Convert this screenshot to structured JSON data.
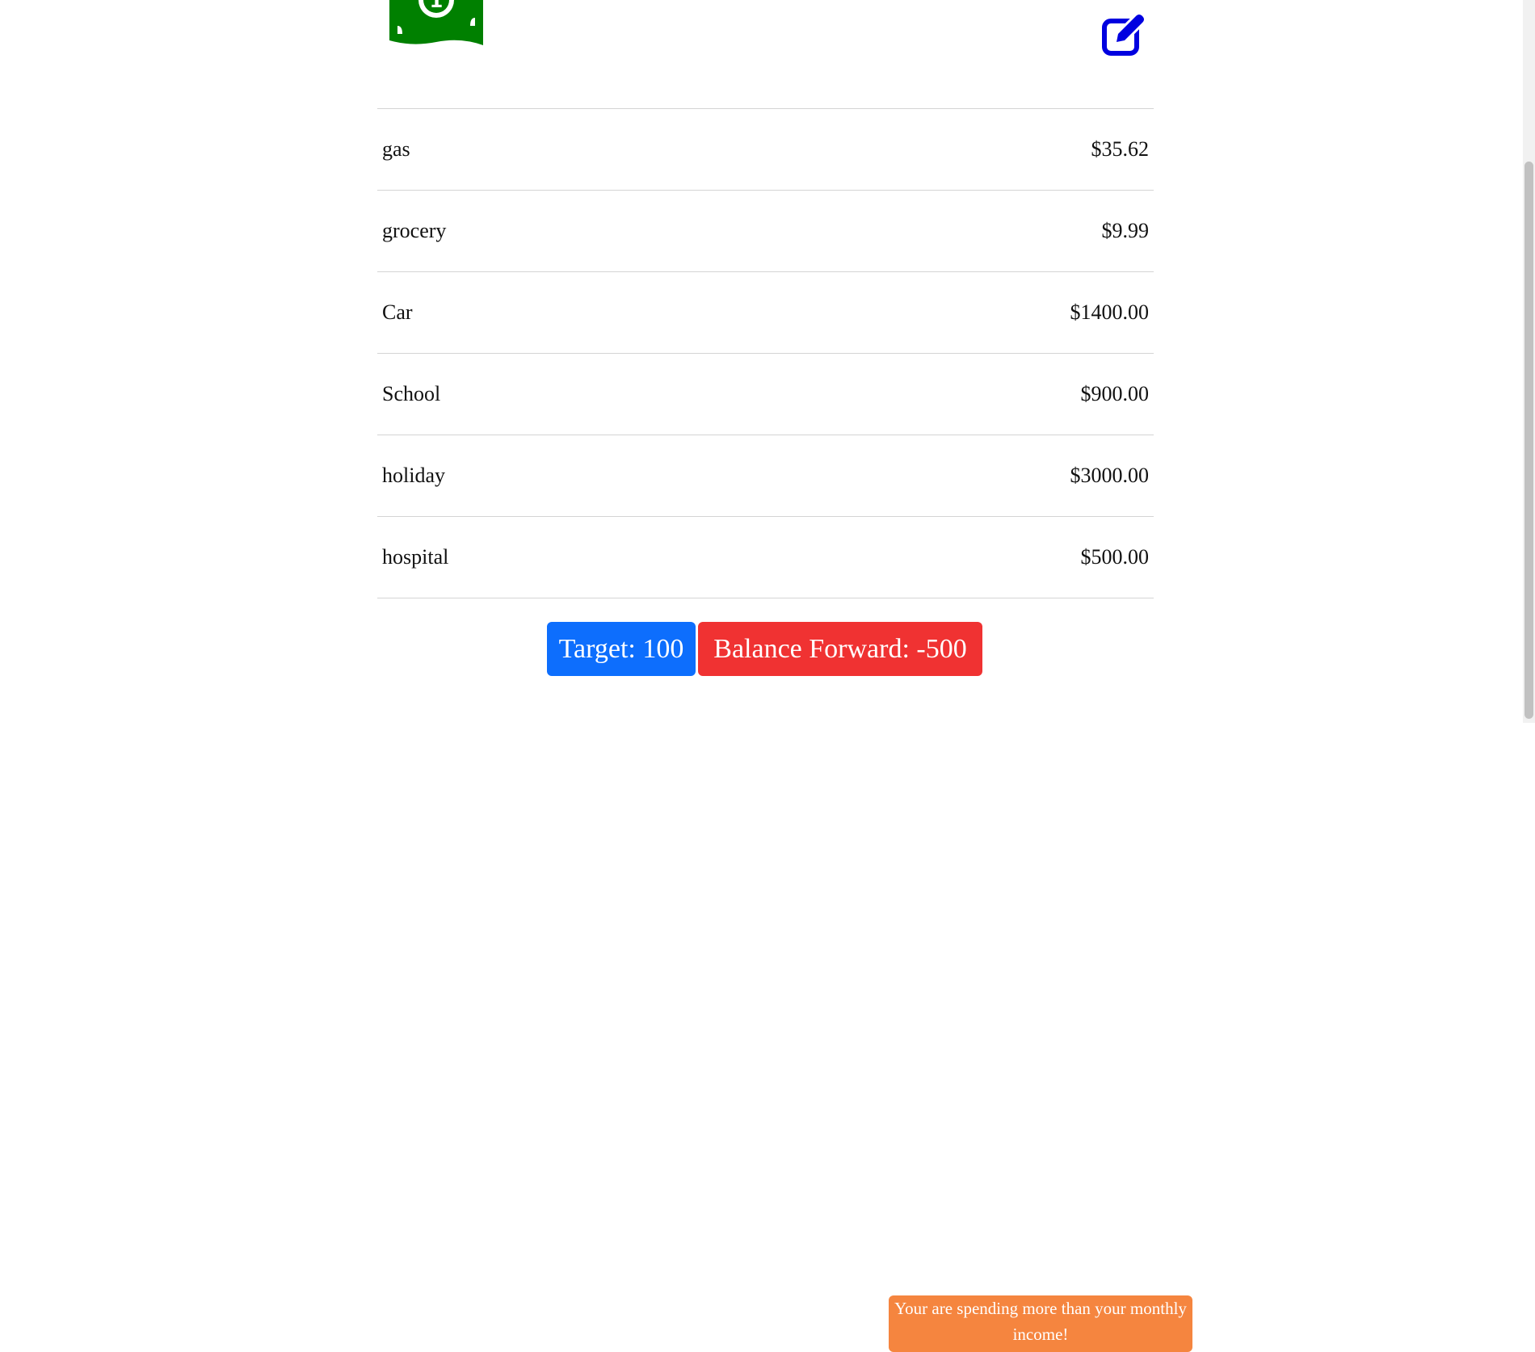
{
  "header": {
    "logo_icon": "money-bill-icon",
    "edit_icon": "edit-icon",
    "logo_color": "#008000",
    "edit_color": "#0000e0"
  },
  "expenses": [
    {
      "name": "gas",
      "amount": "$35.62"
    },
    {
      "name": "grocery",
      "amount": "$9.99"
    },
    {
      "name": "Car",
      "amount": "$1400.00"
    },
    {
      "name": "School",
      "amount": "$900.00"
    },
    {
      "name": "holiday",
      "amount": "$3000.00"
    },
    {
      "name": "hospital",
      "amount": "$500.00"
    }
  ],
  "summary": {
    "target_label": "Target: 100",
    "balance_label": "Balance Forward: -500",
    "warning_text": "Your are spending more than your monthly income!",
    "target_color": "#0d6efd",
    "balance_color": "#f03232",
    "warning_color": "#f5853f"
  }
}
